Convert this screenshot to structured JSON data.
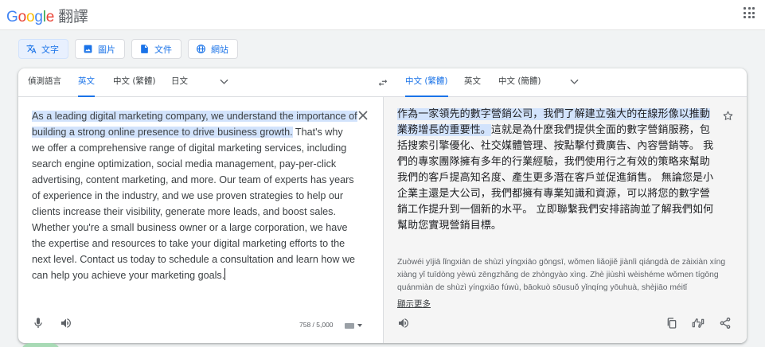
{
  "header": {
    "logo_letters": [
      "G",
      "o",
      "o",
      "g",
      "l",
      "e"
    ],
    "product": "翻譯"
  },
  "modes": [
    {
      "label": "文字",
      "icon": "translate-icon",
      "active": true
    },
    {
      "label": "圖片",
      "icon": "image-icon",
      "active": false
    },
    {
      "label": "文件",
      "icon": "document-icon",
      "active": false
    },
    {
      "label": "網站",
      "icon": "globe-icon",
      "active": false
    }
  ],
  "source_langs": {
    "detect": "偵測語言",
    "english": "英文",
    "chinese_trad": "中文 (繁體)",
    "japanese": "日文"
  },
  "target_langs": {
    "chinese_trad": "中文 (繁體)",
    "english": "英文",
    "chinese_simp": "中文 (簡體)"
  },
  "source": {
    "highlighted": "As a leading digital marketing company, we understand the importance of building a strong online presence to drive business growth.",
    "rest": " That's why we offer a comprehensive range of digital marketing services, including search engine optimization, social media management, pay-per-click advertising, content marketing, and more. Our team of experts has years of experience in the industry, and we use proven strategies to help our clients increase their visibility, generate more leads, and boost sales. Whether you're a small business owner or a large corporation, we have the expertise and resources to take your digital marketing efforts to the next level. Contact us today to schedule a consultation and learn how we can help you achieve your marketing goals.",
    "char_count": "758 / 5,000"
  },
  "target": {
    "highlighted": "作為一家領先的數字營銷公司，我們了解建立強大的在線形像以推動業務增長的重要性。",
    "rest": "這就是為什麼我們提供全面的數字營銷服務，包括搜索引擎優化、社交媒體管理、按點擊付費廣告、內容營銷等。 我們的專家團隊擁有多年的行業經驗，我們使用行之有效的策略來幫助我們的客戶提高知名度、產生更多潛在客戶並促進銷售。 無論您是小企業主還是大公司，我們都擁有專業知識和資源，可以將您的數字營銷工作提升到一個新的水平。 立即聯繫我們安排諮詢並了解我們如何幫助您實現營銷目標。",
    "transliteration": "Zuòwéi yījiā lǐngxiān de shùzì yíngxiāo gōngsī, wǒmen liǎojiě jiànlì qiángdà de zàixiàn xíng xiàng yǐ tuīdòng yèwù zēngzhǎng de zhòngyào xìng. Zhè jiùshì wèishéme wǒmen tígōng quánmiàn de shùzì yíngxiāo fúwù, bāokuò sōusuǒ yǐnqíng yōuhuà, shèjiāo méitǐ",
    "show_more": "顯示更多"
  },
  "colors": {
    "accent": "#1a73e8",
    "highlight": "#d2e3fc",
    "target_bg": "#f5f5f5"
  }
}
